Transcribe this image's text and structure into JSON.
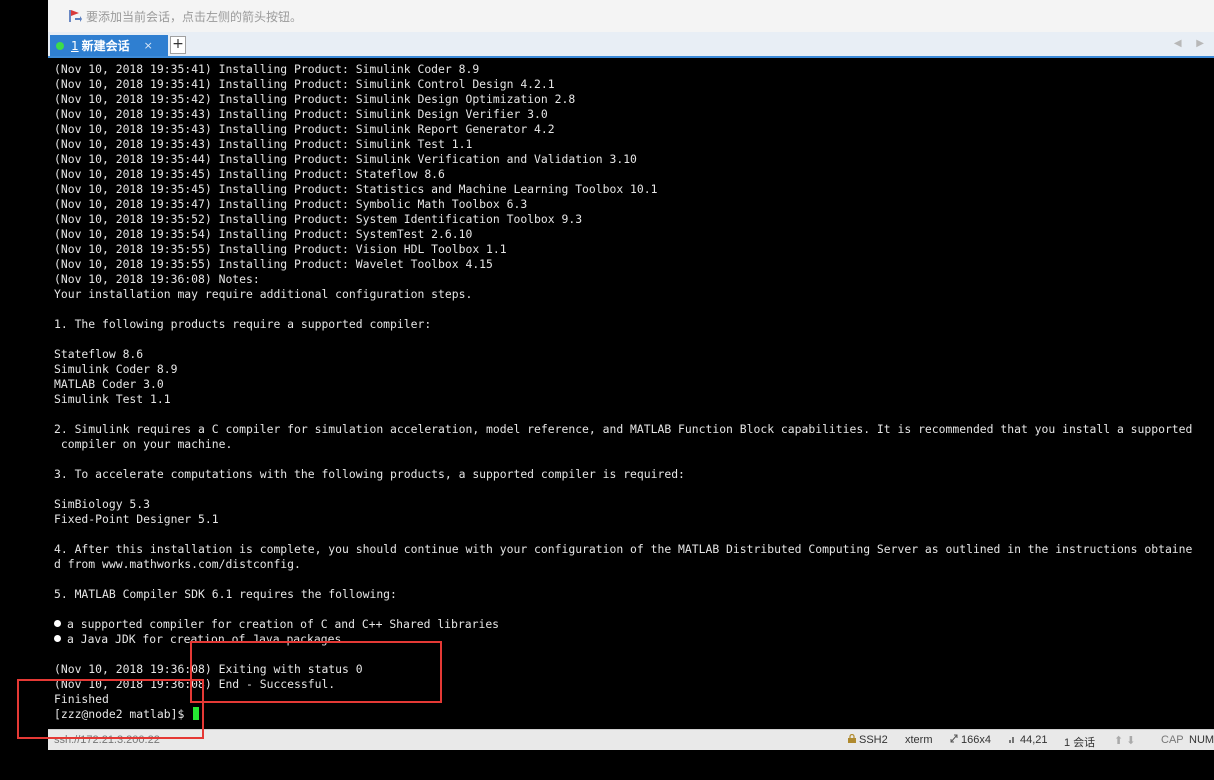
{
  "hint_bar": {
    "text": "要添加当前会话，点击左侧的箭头按钮。"
  },
  "tabs": [
    {
      "number": "1",
      "label": "新建会话",
      "close": "×"
    }
  ],
  "tab_add_label": "+",
  "tab_nav": "◀ ▶",
  "terminal": {
    "lines": [
      "(Nov 10, 2018 19:35:41) Installing Product: Simulink Coder 8.9",
      "(Nov 10, 2018 19:35:41) Installing Product: Simulink Control Design 4.2.1",
      "(Nov 10, 2018 19:35:42) Installing Product: Simulink Design Optimization 2.8",
      "(Nov 10, 2018 19:35:43) Installing Product: Simulink Design Verifier 3.0",
      "(Nov 10, 2018 19:35:43) Installing Product: Simulink Report Generator 4.2",
      "(Nov 10, 2018 19:35:43) Installing Product: Simulink Test 1.1",
      "(Nov 10, 2018 19:35:44) Installing Product: Simulink Verification and Validation 3.10",
      "(Nov 10, 2018 19:35:45) Installing Product: Stateflow 8.6",
      "(Nov 10, 2018 19:35:45) Installing Product: Statistics and Machine Learning Toolbox 10.1",
      "(Nov 10, 2018 19:35:47) Installing Product: Symbolic Math Toolbox 6.3",
      "(Nov 10, 2018 19:35:52) Installing Product: System Identification Toolbox 9.3",
      "(Nov 10, 2018 19:35:54) Installing Product: SystemTest 2.6.10",
      "(Nov 10, 2018 19:35:55) Installing Product: Vision HDL Toolbox 1.1",
      "(Nov 10, 2018 19:35:55) Installing Product: Wavelet Toolbox 4.15",
      "(Nov 10, 2018 19:36:08) Notes:",
      "Your installation may require additional configuration steps.",
      "",
      "1. The following products require a supported compiler:",
      "",
      "Stateflow 8.6",
      "Simulink Coder 8.9",
      "MATLAB Coder 3.0",
      "Simulink Test 1.1",
      "",
      "2. Simulink requires a C compiler for simulation acceleration, model reference, and MATLAB Function Block capabilities. It is recommended that you install a supported",
      " compiler on your machine.",
      "",
      "3. To accelerate computations with the following products, a supported compiler is required:",
      "",
      "SimBiology 5.3",
      "Fixed-Point Designer 5.1",
      "",
      "4. After this installation is complete, you should continue with your configuration of the MATLAB Distributed Computing Server as outlined in the instructions obtaine",
      "d from www.mathworks.com/distconfig.",
      "",
      "5. MATLAB Compiler SDK 6.1 requires the following:",
      "",
      "a supported compiler for creation of C and C++ Shared libraries",
      "a Java JDK for creation of Java packages",
      "",
      "(Nov 10, 2018 19:36:08) Exiting with status 0",
      "(Nov 10, 2018 19:36:08) End - Successful.",
      "Finished",
      "[zzz@node2 matlab]$ "
    ],
    "bullet_lines": [
      37,
      38
    ],
    "prompt_line": 43,
    "cursor_color": "#25e832"
  },
  "status_bar": {
    "connection": "ssh://172.21.3.200:22",
    "protocol": "SSH2",
    "terminal_type": "xterm",
    "size": "166x4",
    "position": "44,21",
    "sessions": "1 会话",
    "cap": "CAP",
    "num": "NUM"
  },
  "colors": {
    "tab_active": "#2f7fd1",
    "tab_bar_accent": "#3c8ad8",
    "annotation_red": "#e53935",
    "terminal_bg": "#000000",
    "terminal_fg": "#e6e6e6"
  },
  "icons": {
    "hint": "flag-arrow-icon",
    "tab_status": "green-dot-icon"
  }
}
